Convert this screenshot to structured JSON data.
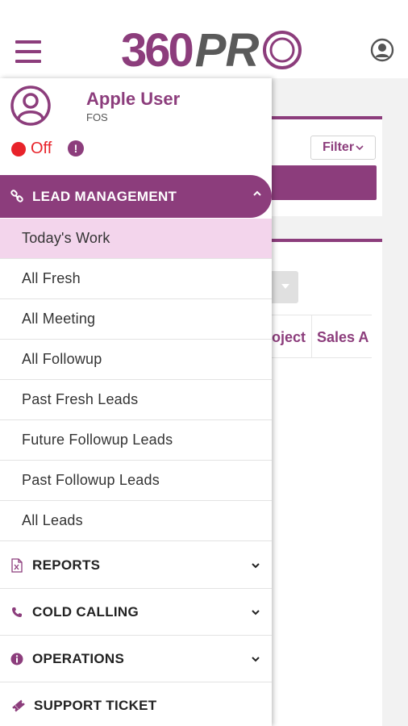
{
  "app": {
    "logo_number": "360",
    "logo_text": "PR",
    "brand_color": "#8c3d7c"
  },
  "background": {
    "filter_label": "Filter",
    "column_1": "oject",
    "column_2": "Sales A"
  },
  "user": {
    "name": "Apple User",
    "role": "FOS",
    "status": "Off",
    "status_color": "#e8232a"
  },
  "menu": {
    "lead_management": {
      "label": "LEAD MANAGEMENT",
      "icon": "link-icon",
      "expanded": true,
      "items": [
        "Today's Work",
        "All Fresh",
        "All Meeting",
        "All Followup",
        "Past Fresh Leads",
        "Future Followup Leads",
        "Past Followup Leads",
        "All Leads"
      ],
      "active_index": 0
    },
    "sections": [
      {
        "label": "REPORTS",
        "icon": "excel-file-icon"
      },
      {
        "label": "COLD CALLING",
        "icon": "phone-icon"
      },
      {
        "label": "OPERATIONS",
        "icon": "info-icon"
      },
      {
        "label": "SUPPORT TICKET",
        "icon": "ticket-icon"
      }
    ]
  }
}
